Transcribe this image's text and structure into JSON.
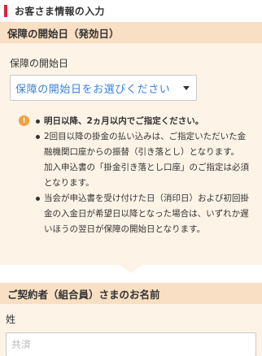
{
  "header": {
    "title": "お客さま情報の入力"
  },
  "coverage_section": {
    "title": "保障の開始日（発効日）",
    "field_label": "保障の開始日",
    "select_value": "保障の開始日をお選びください",
    "notices": [
      {
        "text": "明日以降、2ヵ月以内でご指定ください。",
        "bold": true
      },
      {
        "text": "2回目以降の掛金の払い込みは、ご指定いただいた金融機関口座からの振替（引き落とし）となります。",
        "sub": "加入申込書の「掛金引き落とし口座」のご指定は必須となります。"
      },
      {
        "text": "当会が申込書を受け付けた日（消印日）および初回掛金の入金日が希望日以降となった場合は、いずれか遅いほうの翌日が保障の開始日となります。"
      }
    ]
  },
  "name_section": {
    "title": "ご契約者（組合員）さまのお名前",
    "surname_label": "姓",
    "surname_placeholder": "共済"
  },
  "colors": {
    "accent": "#d7263d",
    "section_bar": "#f9dfc3",
    "panel": "#fdf3e7",
    "link_blue": "#3b82d6",
    "notice_icon": "#f0a040"
  }
}
